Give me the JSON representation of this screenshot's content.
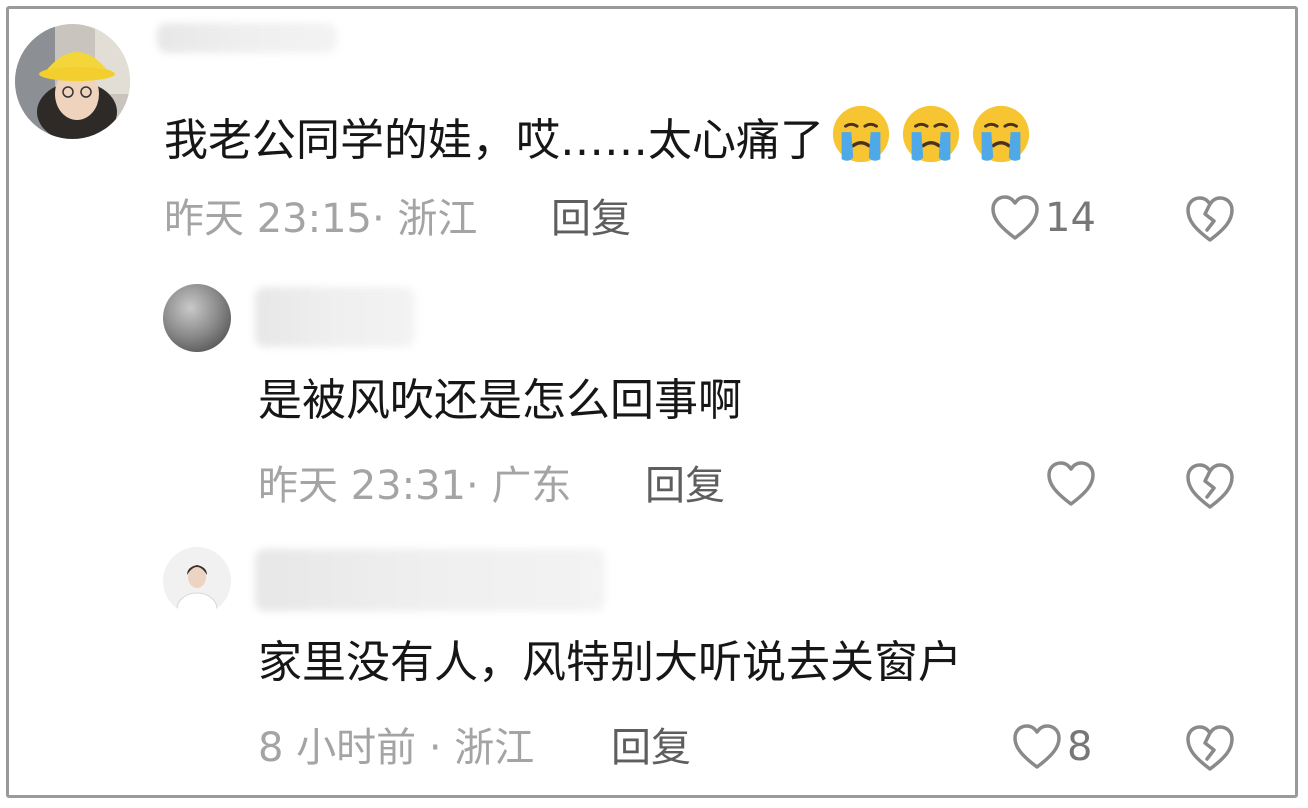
{
  "comments": [
    {
      "text": "我老公同学的娃，哎……太心痛了",
      "emojis": [
        "crying-face",
        "crying-face",
        "crying-face"
      ],
      "time_location": "昨天 23:15· 浙江",
      "reply_label": "回复",
      "like_count": "14"
    },
    {
      "text": "是被风吹还是怎么回事啊",
      "time_location": "昨天 23:31· 广东",
      "reply_label": "回复",
      "like_count": ""
    },
    {
      "text": "家里没有人，风特别大听说去关窗户",
      "time_location": "8 小时前 · 浙江",
      "reply_label": "回复",
      "like_count": "8"
    }
  ],
  "icons": {
    "like": "heart-outline-icon",
    "dislike": "broken-heart-icon"
  },
  "colors": {
    "text": "#161616",
    "meta": "#a4a4a4",
    "reply": "#5e5e5e",
    "icon": "#8a8a8a",
    "frame": "#9a9a9a"
  }
}
